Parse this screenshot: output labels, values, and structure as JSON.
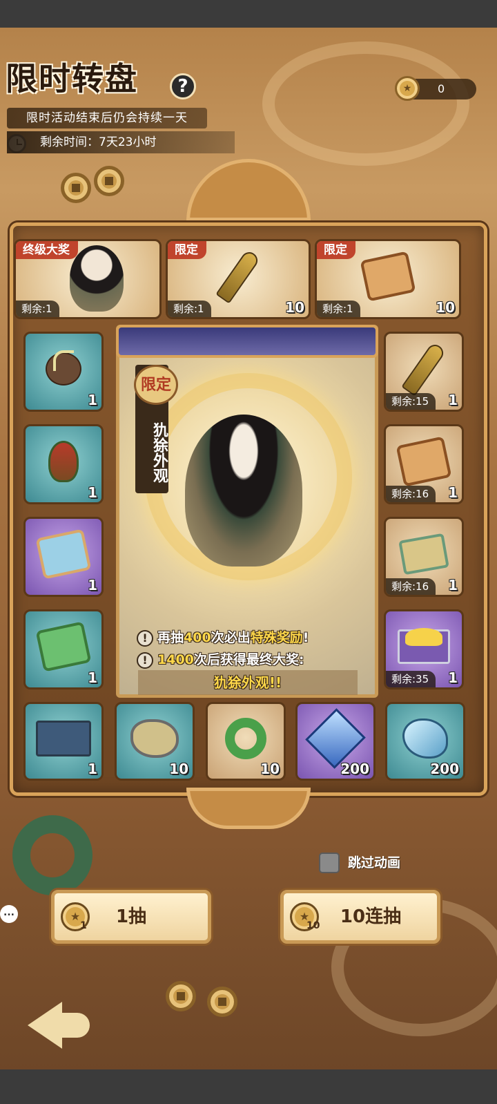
{
  "header": {
    "title": "限时转盘",
    "help_icon": "?",
    "subtitle": "限时活动结束后仍会持续一天",
    "timer_label": "剩余时间：",
    "timer_value": "7天23小时",
    "currency_count": "0"
  },
  "top_prizes": [
    {
      "tag": "终级大奖",
      "remaining": "剩余:1",
      "count": "",
      "icon": "hero-avatar"
    },
    {
      "tag": "限定",
      "remaining": "剩余:1",
      "count": "10",
      "icon": "golden-key"
    },
    {
      "tag": "限定",
      "remaining": "剩余:1",
      "count": "10",
      "icon": "gold-ticket"
    }
  ],
  "left_items": [
    {
      "count": "1",
      "icon": "seed-sprout"
    },
    {
      "count": "1",
      "icon": "flower-bud"
    },
    {
      "count": "1",
      "icon": "blue-scroll"
    },
    {
      "count": "1",
      "icon": "green-scroll"
    }
  ],
  "right_items": [
    {
      "remaining": "剩余:15",
      "count": "1",
      "icon": "golden-key"
    },
    {
      "remaining": "剩余:16",
      "count": "1",
      "icon": "gold-ticket"
    },
    {
      "remaining": "剩余:16",
      "count": "1",
      "icon": "jade-spoon"
    },
    {
      "remaining": "剩余:35",
      "count": "1",
      "icon": "flame-chest"
    }
  ],
  "bottom_items": [
    {
      "count": "1",
      "icon": "mystery-chest"
    },
    {
      "count": "10",
      "icon": "ore-rock"
    },
    {
      "count": "10",
      "icon": "jade-ring"
    },
    {
      "count": "200",
      "icon": "blue-crystal"
    },
    {
      "count": "200",
      "icon": "spirit-stone"
    }
  ],
  "center": {
    "banner_tag": "限定",
    "banner_name": "犰狳外观",
    "line1_prefix": "再抽",
    "line1_num": "400",
    "line1_mid": "次必出",
    "line1_reward": "特殊奖励",
    "line1_suffix": "!",
    "line2_num": "1400",
    "line2_text": "次后获得最终大奖:",
    "final_reward": "犰狳外观!!"
  },
  "controls": {
    "skip_label": "跳过动画",
    "draw1_label": "1抽",
    "draw1_cost": "1",
    "draw10_label": "10连抽",
    "draw10_cost": "10",
    "chat_icon": "..."
  },
  "colors": {
    "accent_yellow": "#ffd84a",
    "tag_red": "#c0442c",
    "frame_gold": "#d9a35a"
  }
}
